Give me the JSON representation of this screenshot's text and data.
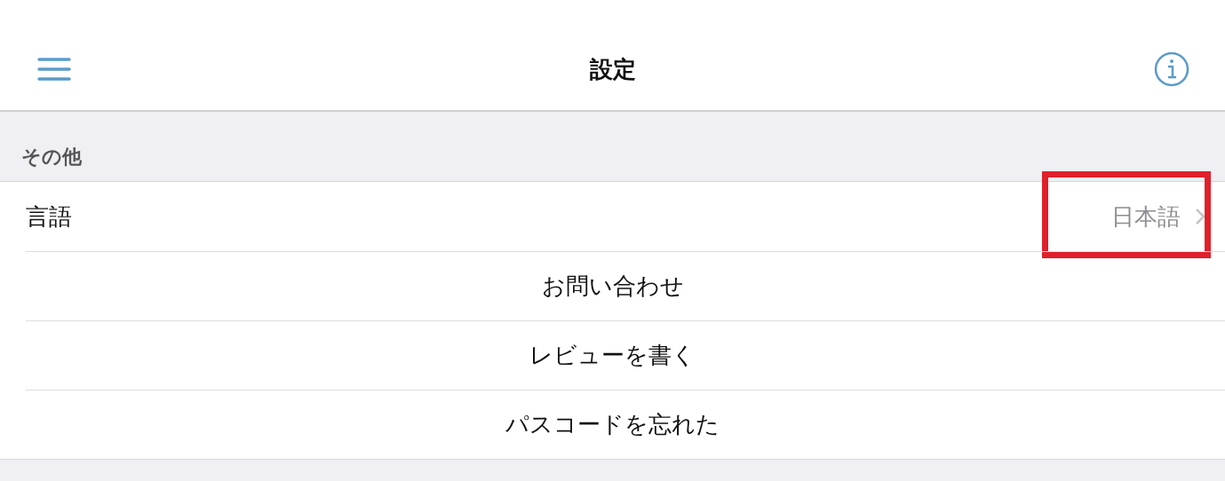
{
  "nav_bar": {
    "title": "設定"
  },
  "section": {
    "header": "その他",
    "rows": [
      {
        "kind": "detail",
        "label": "言語",
        "value": "日本語",
        "highlighted": true
      },
      {
        "kind": "action",
        "label": "お問い合わせ",
        "highlighted": false
      },
      {
        "kind": "action",
        "label": "レビューを書く",
        "highlighted": false
      },
      {
        "kind": "action",
        "label": "パスコードを忘れた",
        "highlighted": false
      }
    ]
  }
}
